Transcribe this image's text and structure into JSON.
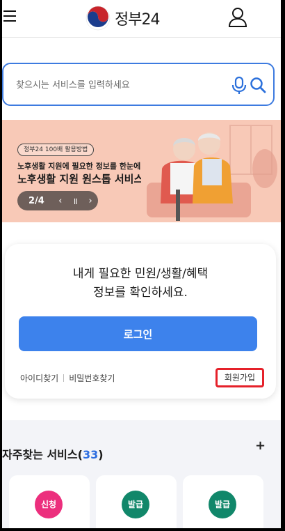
{
  "header": {
    "logo_text": "정부24",
    "menu_icon": "hamburger-menu-icon",
    "user_icon": "user-icon"
  },
  "search": {
    "placeholder": "찾으시는 서비스를 입력하세요",
    "value": ""
  },
  "banner": {
    "tag": "정부24 100배 활용방법",
    "subtitle": "노후생활 지원에 필요한 정보를 한눈에!",
    "title": "노후생활 지원 원스톱 서비스",
    "counter": "2/4",
    "prev": "‹",
    "pause": "॥",
    "next": "›",
    "bg_color": "#f8c9b7"
  },
  "login_card": {
    "message_line1": "내게 필요한 민원/생활/혜택",
    "message_line2": "정보를 확인하세요.",
    "login_label": "로그인",
    "find_id": "아이디찾기",
    "find_password": "비밀번호찾기",
    "signup": "회원가입",
    "button_color": "#3d82ec"
  },
  "frequent_services": {
    "title": "자주찾는 서비스",
    "count_open": "(",
    "count": "33",
    "count_close": ")",
    "plus": "+",
    "items": [
      {
        "badge": "신청",
        "color": "#ec2f7d"
      },
      {
        "badge": "발급",
        "color": "#11876a"
      },
      {
        "badge": "발급",
        "color": "#11876a"
      }
    ]
  }
}
